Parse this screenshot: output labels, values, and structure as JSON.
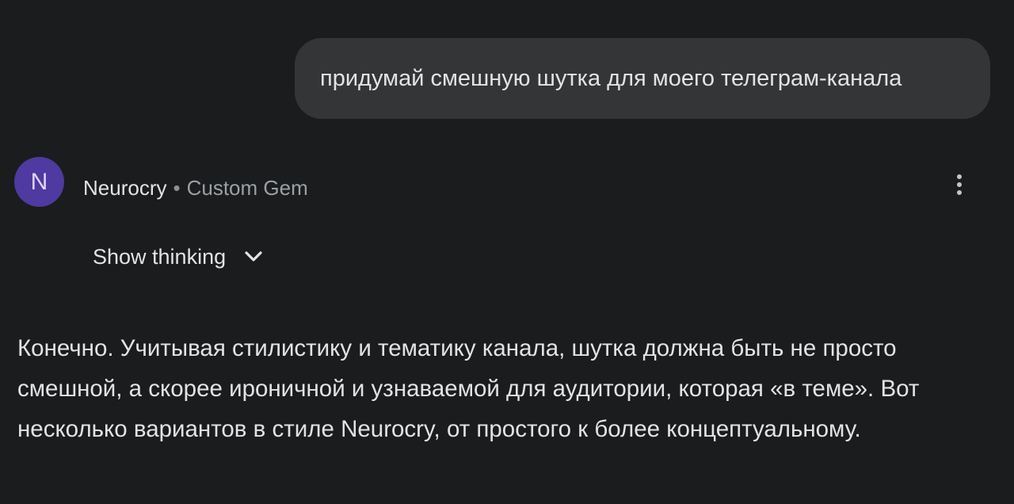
{
  "user_message": {
    "text": "придумай смешную шутка для моего телеграм-канала"
  },
  "model": {
    "avatar_letter": "N",
    "name": "Neurocry",
    "separator": "•",
    "subtitle": "Custom Gem",
    "more_icon": "more-vert-icon"
  },
  "thinking": {
    "label": "Show thinking",
    "icon": "chevron-down-icon"
  },
  "response": {
    "text": "Конечно. Учитывая стилистику и тематику канала, шутка должна быть не просто смешной, а скорее ироничной и узнаваемой для аудитории, которая «в теме». Вот несколько вариантов в стиле Neurocry, от простого к более концептуальному."
  },
  "colors": {
    "background": "#1b1c1d",
    "user_bubble": "#333537",
    "avatar": "#4e3aa0",
    "text": "#e3e3e3",
    "muted_text": "#9aa0a6"
  }
}
